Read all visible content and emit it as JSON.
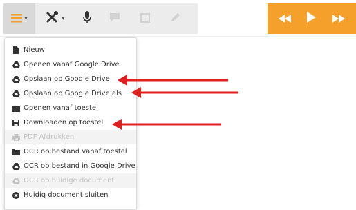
{
  "toolbar": {
    "icons": [
      "hamburger-menu-icon",
      "tools-icon",
      "microphone-icon",
      "comment-icon",
      "frame-icon",
      "pencil-icon"
    ],
    "caret": "▾",
    "accent_color": "#f5a02a",
    "playback_icons": [
      "rewind-icon",
      "play-icon",
      "fast-forward-icon"
    ]
  },
  "menu": {
    "items": [
      {
        "label": "Nieuw",
        "icon": "document-icon",
        "disabled": false
      },
      {
        "label": "Openen vanaf Google Drive",
        "icon": "google-drive-icon",
        "disabled": false
      },
      {
        "label": "Opslaan op Google Drive",
        "icon": "google-drive-icon",
        "disabled": false
      },
      {
        "label": "Opslaan op Google Drive als",
        "icon": "google-drive-icon",
        "disabled": false
      },
      {
        "label": "Openen vanaf toestel",
        "icon": "folder-icon",
        "disabled": false
      },
      {
        "label": "Downloaden op toestel",
        "icon": "save-icon",
        "disabled": false
      },
      {
        "label": "PDF Afdrukken",
        "icon": "printer-icon",
        "disabled": true
      },
      {
        "label": "OCR op bestand vanaf toestel",
        "icon": "folder-icon",
        "disabled": false
      },
      {
        "label": "OCR op bestand in Google Drive",
        "icon": "google-drive-icon",
        "disabled": false
      },
      {
        "label": "OCR op huidige document",
        "icon": "google-drive-icon",
        "disabled": true
      },
      {
        "label": "Huidig document sluiten",
        "icon": "close-circle-icon",
        "disabled": false
      }
    ]
  },
  "annotation_color": "#e02020"
}
